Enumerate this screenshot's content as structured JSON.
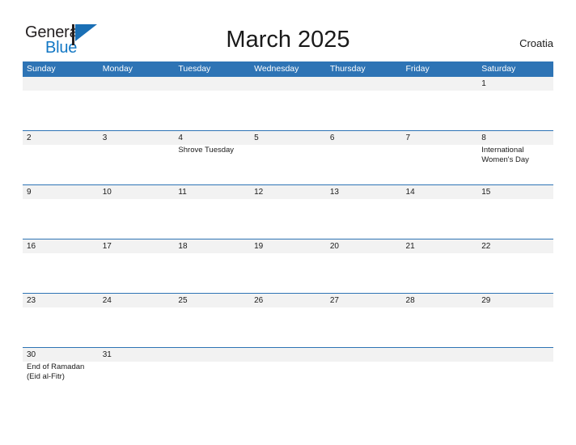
{
  "header": {
    "logo": {
      "text_primary": "General",
      "text_secondary": "Blue",
      "mark_icon": "general-blue-triangle-logo-icon"
    },
    "title": "March 2025",
    "country": "Croatia"
  },
  "calendar": {
    "day_headers": [
      "Sunday",
      "Monday",
      "Tuesday",
      "Wednesday",
      "Thursday",
      "Friday",
      "Saturday"
    ],
    "colors": {
      "header_blue": "#2e74b5",
      "date_band_grey": "#f2f2f2",
      "logo_blue": "#1277c4",
      "text": "#1a1a1a"
    },
    "weeks": [
      {
        "days": [
          {
            "num": "",
            "event": ""
          },
          {
            "num": "",
            "event": ""
          },
          {
            "num": "",
            "event": ""
          },
          {
            "num": "",
            "event": ""
          },
          {
            "num": "",
            "event": ""
          },
          {
            "num": "",
            "event": ""
          },
          {
            "num": "1",
            "event": ""
          }
        ]
      },
      {
        "days": [
          {
            "num": "2",
            "event": ""
          },
          {
            "num": "3",
            "event": ""
          },
          {
            "num": "4",
            "event": "Shrove Tuesday"
          },
          {
            "num": "5",
            "event": ""
          },
          {
            "num": "6",
            "event": ""
          },
          {
            "num": "7",
            "event": ""
          },
          {
            "num": "8",
            "event": "International\nWomen's Day"
          }
        ]
      },
      {
        "days": [
          {
            "num": "9",
            "event": ""
          },
          {
            "num": "10",
            "event": ""
          },
          {
            "num": "11",
            "event": ""
          },
          {
            "num": "12",
            "event": ""
          },
          {
            "num": "13",
            "event": ""
          },
          {
            "num": "14",
            "event": ""
          },
          {
            "num": "15",
            "event": ""
          }
        ]
      },
      {
        "days": [
          {
            "num": "16",
            "event": ""
          },
          {
            "num": "17",
            "event": ""
          },
          {
            "num": "18",
            "event": ""
          },
          {
            "num": "19",
            "event": ""
          },
          {
            "num": "20",
            "event": ""
          },
          {
            "num": "21",
            "event": ""
          },
          {
            "num": "22",
            "event": ""
          }
        ]
      },
      {
        "days": [
          {
            "num": "23",
            "event": ""
          },
          {
            "num": "24",
            "event": ""
          },
          {
            "num": "25",
            "event": ""
          },
          {
            "num": "26",
            "event": ""
          },
          {
            "num": "27",
            "event": ""
          },
          {
            "num": "28",
            "event": ""
          },
          {
            "num": "29",
            "event": ""
          }
        ]
      },
      {
        "days": [
          {
            "num": "30",
            "event": "End of Ramadan\n(Eid al-Fitr)"
          },
          {
            "num": "31",
            "event": ""
          },
          {
            "num": "",
            "event": ""
          },
          {
            "num": "",
            "event": ""
          },
          {
            "num": "",
            "event": ""
          },
          {
            "num": "",
            "event": ""
          },
          {
            "num": "",
            "event": ""
          }
        ]
      }
    ]
  }
}
